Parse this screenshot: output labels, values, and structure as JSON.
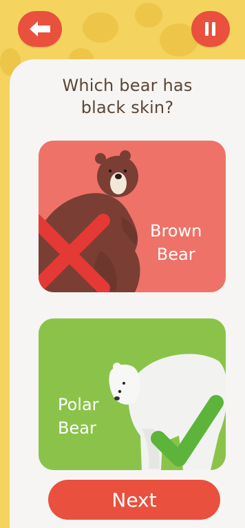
{
  "header": {
    "back_icon": "arrow-left-icon",
    "pause_icon": "pause-icon",
    "accent_color": "#E9503D",
    "banner_color": "#F4D35E"
  },
  "question": {
    "line1": "Which bear has",
    "line2": "black skin?"
  },
  "answers": [
    {
      "label_line1": "Brown",
      "label_line2": "Bear",
      "result": "incorrect",
      "result_icon": "cross-icon",
      "color": "#EE7268"
    },
    {
      "label_line1": "Polar",
      "label_line2": "Bear",
      "result": "correct",
      "result_icon": "check-icon",
      "color": "#8BC34A"
    }
  ],
  "next_button": {
    "label": "Next"
  }
}
